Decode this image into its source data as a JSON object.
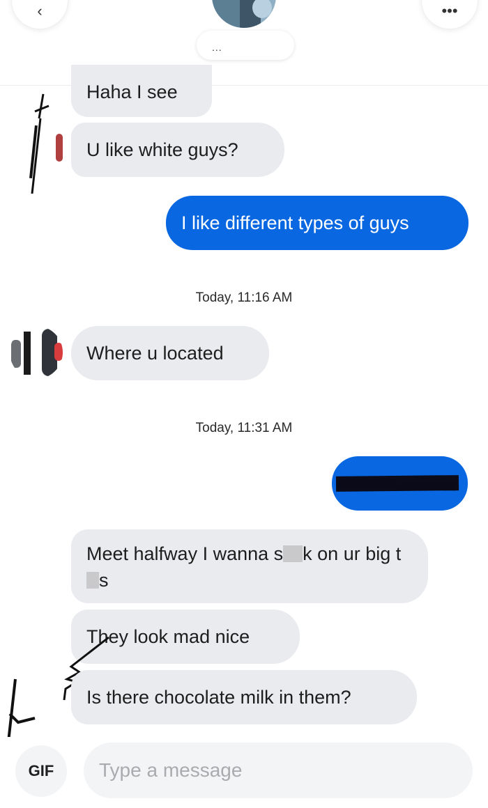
{
  "header": {
    "back_glyph": "‹",
    "more_glyph": "•••",
    "match_name": "..."
  },
  "messages": [
    {
      "id": "m1",
      "direction": "incoming",
      "text": "Haha I see"
    },
    {
      "id": "m2",
      "direction": "incoming",
      "text": "U like white guys?"
    },
    {
      "id": "m3",
      "direction": "outgoing",
      "text": "I like different types of guys"
    },
    {
      "id": "m4",
      "direction": "incoming",
      "text": "Where u located"
    },
    {
      "id": "m5",
      "direction": "outgoing",
      "text": ""
    },
    {
      "id": "m6",
      "direction": "incoming",
      "text_parts": [
        "Meet halfway I wanna s",
        "k on ur big t",
        "s"
      ]
    },
    {
      "id": "m7",
      "direction": "incoming",
      "text": "They look mad nice"
    },
    {
      "id": "m8",
      "direction": "incoming",
      "text": "Is there chocolate milk in them?"
    }
  ],
  "timestamps": [
    "Today, 11:16 AM",
    "Today, 11:31 AM"
  ],
  "composer": {
    "gif_label": "GIF",
    "placeholder": "Type a message"
  },
  "colors": {
    "outgoing_bubble": "#0867e1",
    "incoming_bubble": "#e9ebef"
  }
}
